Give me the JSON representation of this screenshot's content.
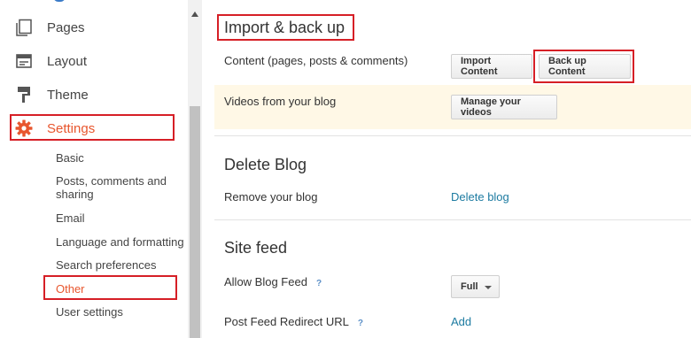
{
  "sidebar": {
    "nav_items": [
      {
        "label": "Pages",
        "icon": "pages-icon"
      },
      {
        "label": "Layout",
        "icon": "layout-icon"
      },
      {
        "label": "Theme",
        "icon": "theme-icon"
      },
      {
        "label": "Settings",
        "icon": "gear-icon",
        "active": true
      }
    ],
    "settings_subitems": [
      {
        "label": "Basic"
      },
      {
        "label": "Posts, comments and sharing"
      },
      {
        "label": "Email"
      },
      {
        "label": "Language and formatting"
      },
      {
        "label": "Search preferences"
      },
      {
        "label": "Other",
        "active": true
      },
      {
        "label": "User settings"
      }
    ]
  },
  "import_backup": {
    "title": "Import & back up",
    "content_label": "Content (pages, posts & comments)",
    "import_button": "Import Content",
    "backup_button": "Back up Content",
    "videos_label": "Videos from your blog",
    "manage_videos_button": "Manage your videos"
  },
  "delete_blog": {
    "title": "Delete Blog",
    "remove_label": "Remove your blog",
    "delete_link": "Delete blog"
  },
  "site_feed": {
    "title": "Site feed",
    "allow_feed_label": "Allow Blog Feed",
    "allow_feed_help": "?",
    "feed_value": "Full",
    "redirect_label": "Post Feed Redirect URL",
    "redirect_help": "?",
    "add_link": "Add"
  },
  "colors": {
    "accent_active": "#e8562e",
    "link": "#1d7ba1",
    "annotation_red": "#d61f26",
    "highlight_row": "#fff8e6"
  }
}
